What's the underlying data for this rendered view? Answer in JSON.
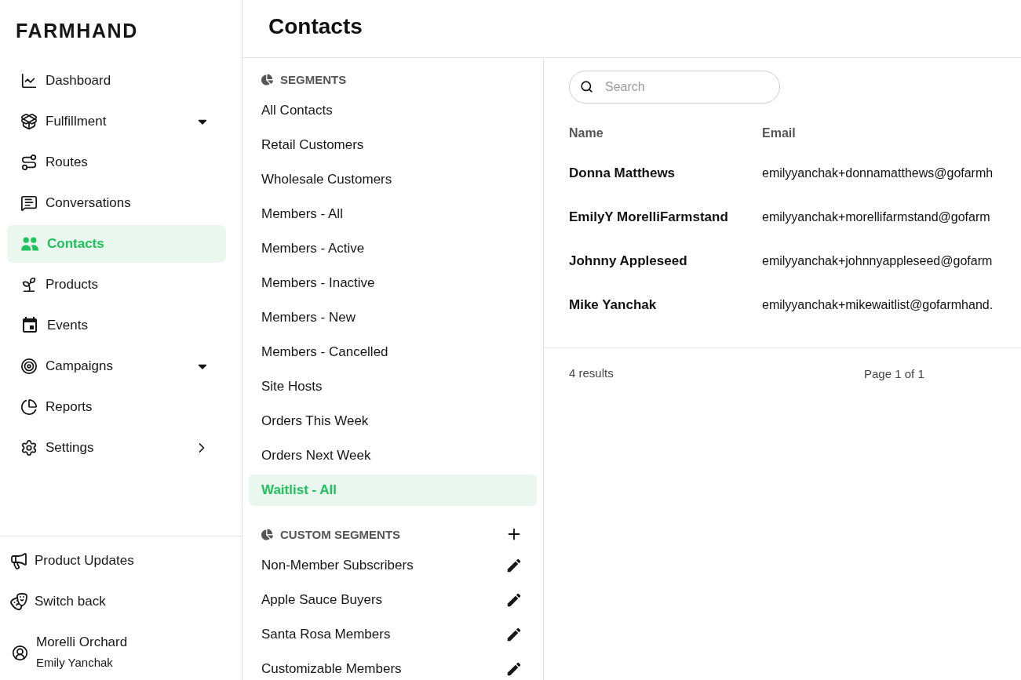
{
  "sidebar": {
    "logo": "FARMHAND",
    "nav": [
      {
        "label": "Dashboard",
        "kind": "link",
        "selected": false
      },
      {
        "label": "Fulfillment",
        "kind": "group",
        "selected": false
      },
      {
        "label": "Routes",
        "kind": "link",
        "selected": false
      },
      {
        "label": "Conversations",
        "kind": "link",
        "selected": false
      },
      {
        "label": "Contacts",
        "kind": "link",
        "selected": true
      },
      {
        "label": "Products",
        "kind": "link",
        "selected": false
      },
      {
        "label": "Events",
        "kind": "link",
        "selected": false
      },
      {
        "label": "Campaigns",
        "kind": "group",
        "selected": false
      },
      {
        "label": "Reports",
        "kind": "link",
        "selected": false
      },
      {
        "label": "Settings",
        "kind": "submenu",
        "selected": false
      }
    ],
    "footer_items": [
      "Product Updates",
      "Switch back"
    ],
    "account": {
      "organization": "Morelli Orchard",
      "user": "Emily Yanchak"
    }
  },
  "header": {
    "title": "Contacts"
  },
  "segments": {
    "title": "SEGMENTS",
    "items": [
      {
        "label": "All Contacts",
        "selected": false
      },
      {
        "label": "Retail Customers",
        "selected": false
      },
      {
        "label": "Wholesale Customers",
        "selected": false
      },
      {
        "label": "Members - All",
        "selected": false
      },
      {
        "label": "Members - Active",
        "selected": false
      },
      {
        "label": "Members - Inactive",
        "selected": false
      },
      {
        "label": "Members - New",
        "selected": false
      },
      {
        "label": "Members - Cancelled",
        "selected": false
      },
      {
        "label": "Site Hosts",
        "selected": false
      },
      {
        "label": "Orders This Week",
        "selected": false
      },
      {
        "label": "Orders Next Week",
        "selected": false
      },
      {
        "label": "Waitlist - All",
        "selected": true
      }
    ]
  },
  "custom_segments": {
    "title": "CUSTOM SEGMENTS",
    "items": [
      {
        "label": "Non-Member Subscribers",
        "selected": false
      },
      {
        "label": "Apple Sauce Buyers",
        "selected": false
      },
      {
        "label": "Santa Rosa Members",
        "selected": false
      },
      {
        "label": "Customizable Members",
        "selected": false
      }
    ]
  },
  "contacts": {
    "search": {
      "placeholder": "Search"
    },
    "columns": [
      "Name",
      "Email"
    ],
    "rows": [
      {
        "name": "Donna Matthews",
        "email": "emilyyanchak+donnamatthews@gofarmh"
      },
      {
        "name": "EmilyY MorelliFarmstand",
        "email": "emilyyanchak+morellifarmstand@gofarm"
      },
      {
        "name": "Johnny Appleseed",
        "email": "emilyyanchak+johnnyappleseed@gofarm"
      },
      {
        "name": "Mike Yanchak",
        "email": "emilyyanchak+mikewaitlist@gofarmhand."
      }
    ],
    "result_count": "4 results",
    "pagination": "Page 1 of 1"
  }
}
